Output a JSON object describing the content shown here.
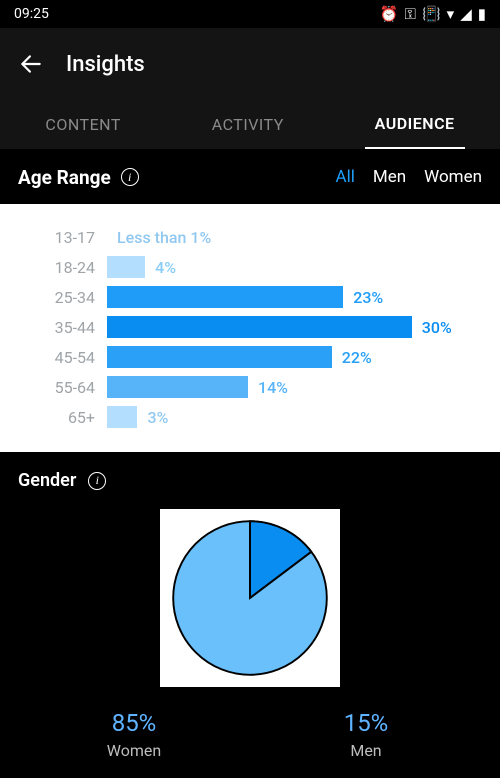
{
  "status": {
    "time": "09:25"
  },
  "header": {
    "title": "Insights"
  },
  "tabs": {
    "content": "CONTENT",
    "activity": "ACTIVITY",
    "audience": "AUDIENCE"
  },
  "age_range": {
    "title": "Age Range",
    "filters": {
      "all": "All",
      "men": "Men",
      "women": "Women"
    }
  },
  "gender_section": {
    "title": "Gender",
    "women_pct": "85%",
    "women_label": "Women",
    "men_pct": "15%",
    "men_label": "Men"
  },
  "chart_data": [
    {
      "type": "bar",
      "title": "Age Range",
      "categories": [
        "13-17",
        "18-24",
        "25-34",
        "35-44",
        "45-54",
        "55-64",
        "65+"
      ],
      "values": [
        0.5,
        4,
        23,
        30,
        22,
        14,
        3
      ],
      "display_values": [
        "Less than 1%",
        "4%",
        "23%",
        "30%",
        "22%",
        "14%",
        "3%"
      ],
      "xlabel": "",
      "ylabel": "",
      "ylim": [
        0,
        30
      ]
    },
    {
      "type": "pie",
      "title": "Gender",
      "categories": [
        "Women",
        "Men"
      ],
      "values": [
        85,
        15
      ]
    }
  ]
}
